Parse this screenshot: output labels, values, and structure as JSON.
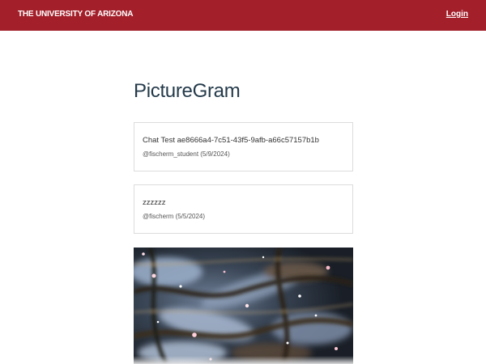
{
  "header": {
    "brand": "THE UNIVERSITY OF ARIZONA",
    "login_label": "Login",
    "color": "#a3202b"
  },
  "page": {
    "title": "PictureGram"
  },
  "posts": [
    {
      "text": "Chat Test ae8666a4-7c51-43f5-9afb-a66c57157b1b",
      "meta": "@fischerm_student (5/9/2024)"
    },
    {
      "text": "zzzzzz",
      "meta": "@fischerm (5/5/2024)"
    }
  ],
  "image_post": {
    "image": "galaxy-nebula-photo"
  }
}
